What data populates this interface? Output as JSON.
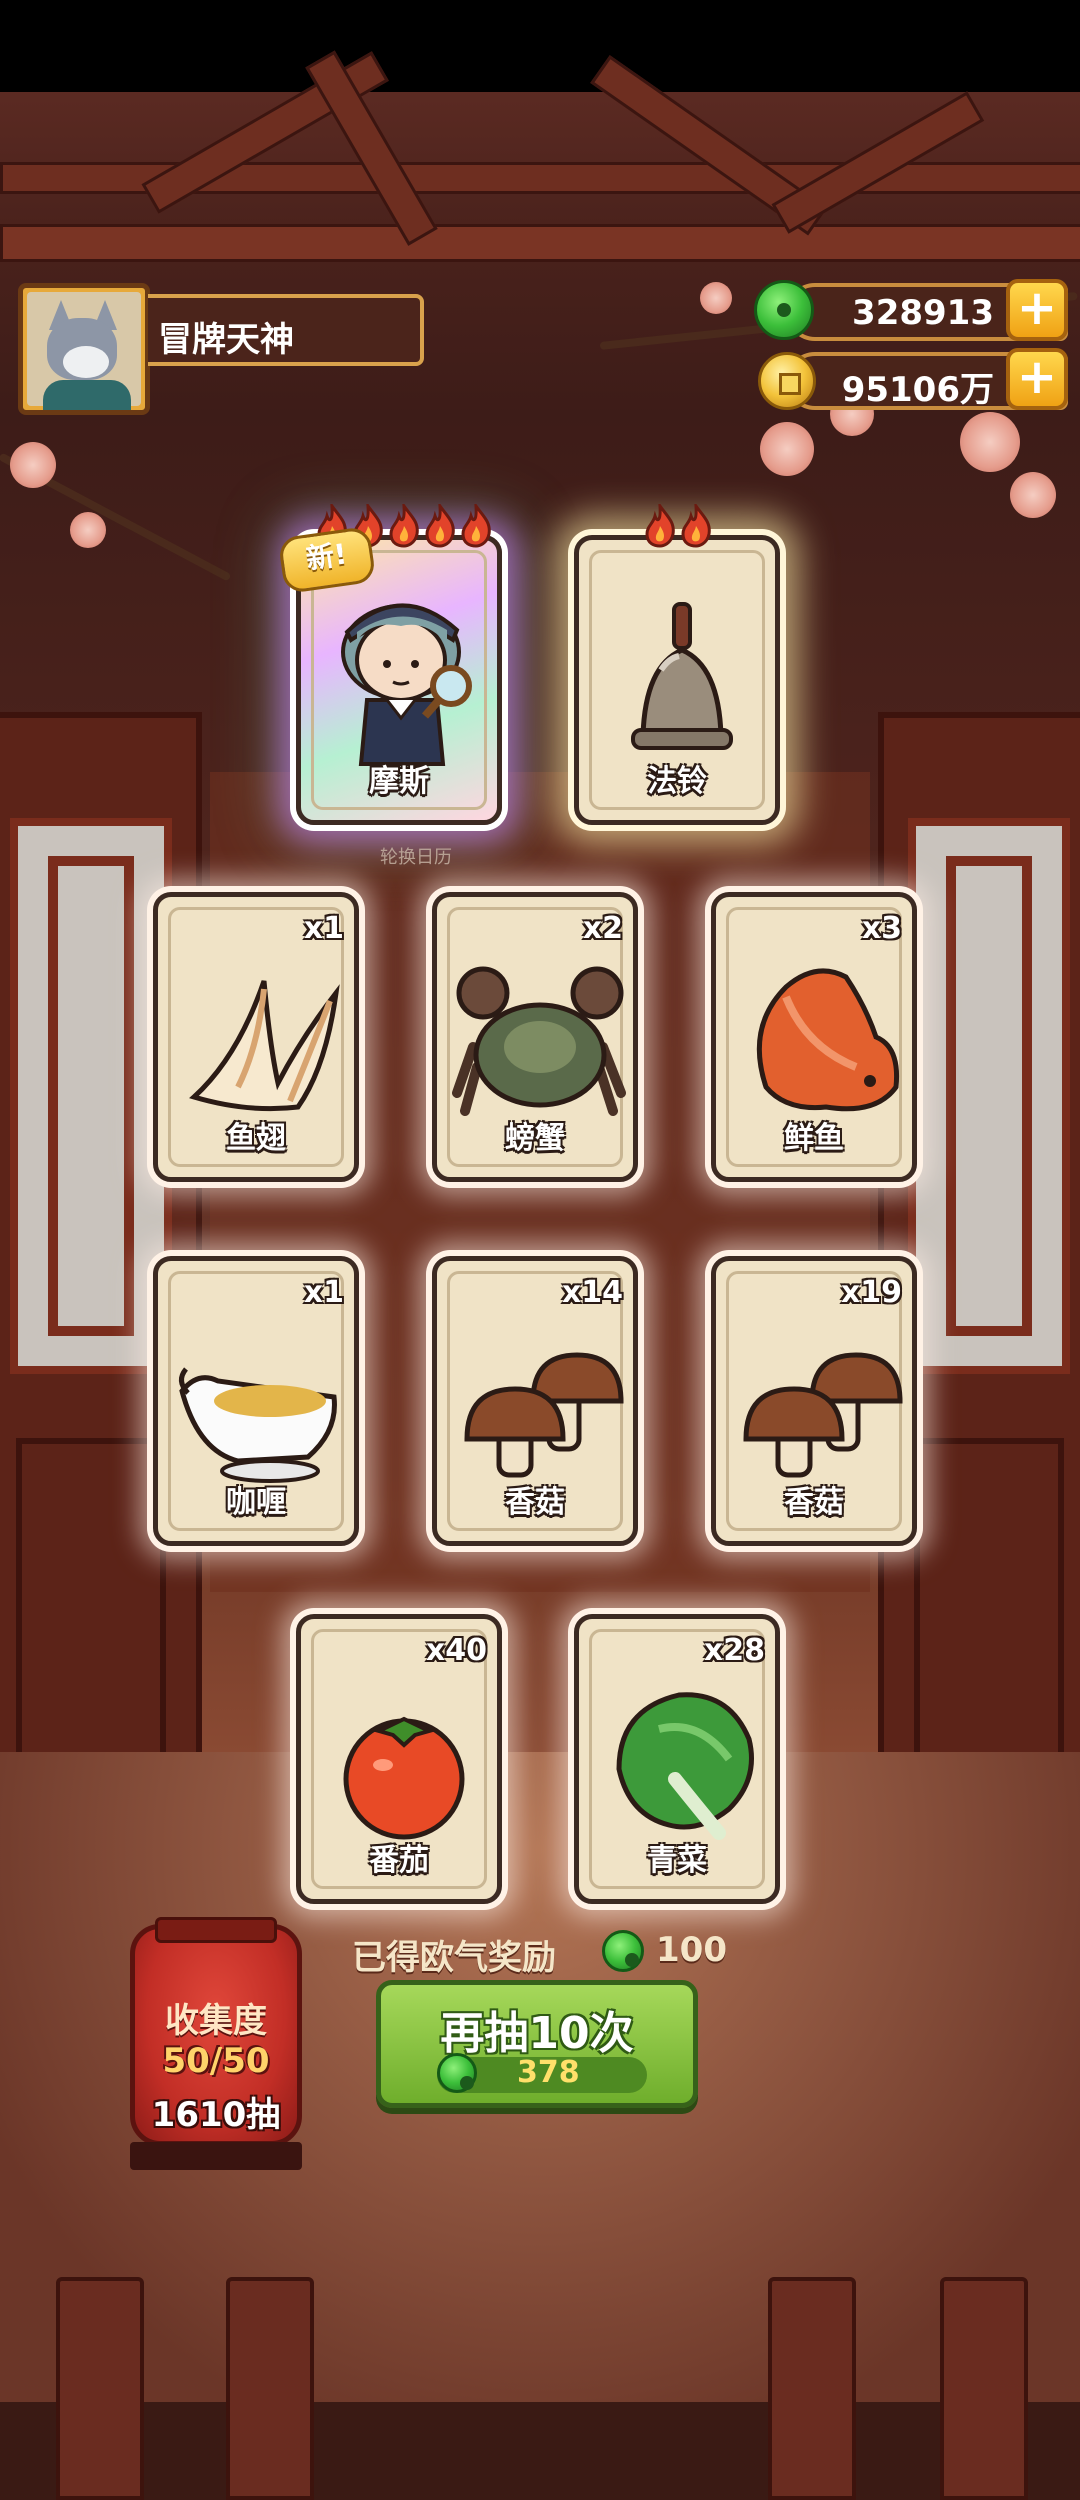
{
  "player": {
    "name": "冒牌天神",
    "avatar": "wolf-avatar"
  },
  "resources": {
    "jade": {
      "value": "328913",
      "icon": "jade-icon"
    },
    "coins": {
      "value": "95106万",
      "icon": "coin-icon"
    }
  },
  "rare_cards": [
    {
      "name": "摩斯",
      "new_tag": "新!",
      "flames": 5,
      "art": "detective-character"
    },
    {
      "name": "法铃",
      "flames": 2,
      "art": "bell"
    }
  ],
  "background_label": "轮换日历",
  "item_cards": [
    {
      "name": "鱼翅",
      "qty": "x1",
      "art": "shark-fin"
    },
    {
      "name": "螃蟹",
      "qty": "x2",
      "art": "crab"
    },
    {
      "name": "鲜鱼",
      "qty": "x3",
      "art": "fish"
    },
    {
      "name": "咖喱",
      "qty": "x1",
      "art": "curry-boat"
    },
    {
      "name": "香菇",
      "qty": "x14",
      "art": "mushroom"
    },
    {
      "name": "香菇",
      "qty": "x19",
      "art": "mushroom"
    },
    {
      "name": "番茄",
      "qty": "x40",
      "art": "tomato"
    },
    {
      "name": "青菜",
      "qty": "x28",
      "art": "greens"
    }
  ],
  "reward": {
    "label": "已得欧气奖励",
    "value": "100"
  },
  "draw_button": {
    "label": "再抽10次",
    "cost": "378"
  },
  "collection": {
    "title": "收集度",
    "progress": "50/50",
    "draws": "1610抽"
  },
  "colors": {
    "accent_green": "#6fae2c",
    "gold": "#f0b42a",
    "lantern_red": "#c22e26"
  }
}
